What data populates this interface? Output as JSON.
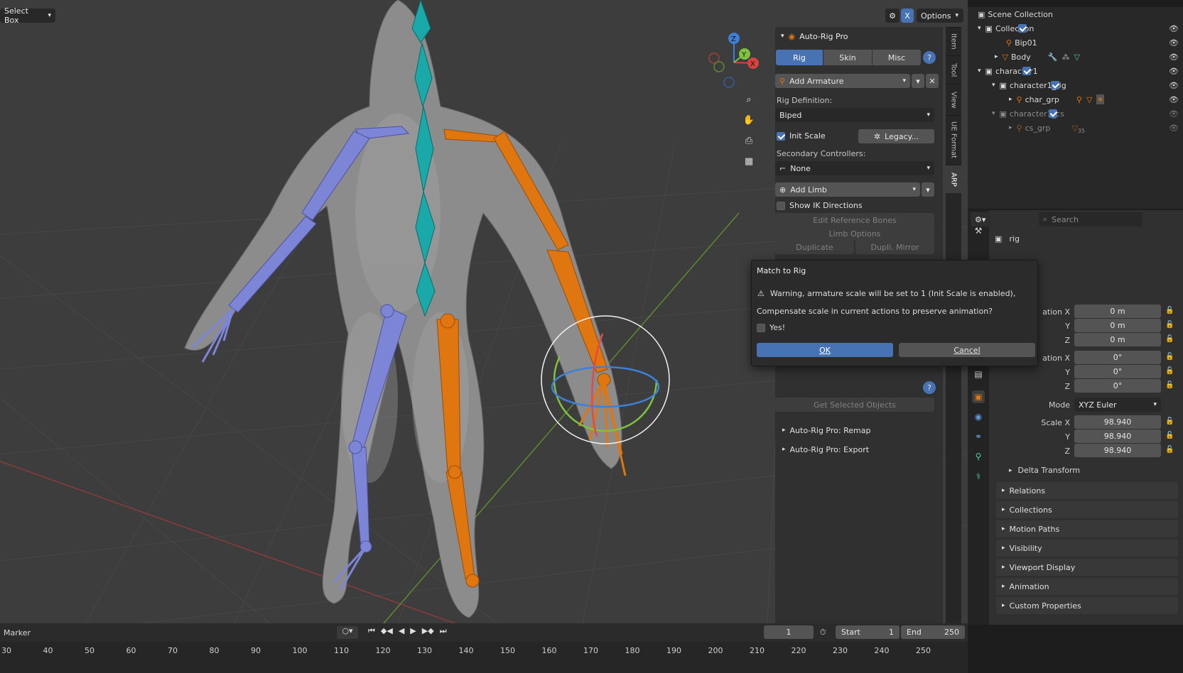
{
  "viewport": {
    "select_mode": "Select Box",
    "options_label": "Options",
    "nav_icons": [
      "zoom-icon",
      "pan-hand-icon",
      "camera-icon",
      "grid-perspective-icon"
    ],
    "gizmo": {
      "x": "X",
      "y": "Y",
      "z": "Z"
    },
    "colors": {
      "left_bones": "#7d85d6",
      "right_bones": "#e0760f",
      "spine_bones": "#1aa8a8",
      "background": "#3d3d3d"
    }
  },
  "side_tabs": [
    "Item",
    "Tool",
    "View",
    "UE Format",
    "ARP"
  ],
  "arp": {
    "title": "Auto-Rig Pro",
    "tabs": [
      "Rig",
      "Skin",
      "Misc"
    ],
    "active_tab": "Rig",
    "add_armature": "Add Armature",
    "rig_definition_label": "Rig Definition:",
    "rig_definition_value": "Biped",
    "init_scale_label": "Init Scale",
    "legacy_label": "Legacy...",
    "secondary_label": "Secondary Controllers:",
    "secondary_value": "None",
    "add_limb": "Add Limb",
    "show_ik": "Show IK Directions",
    "edit_ref_bones": "Edit Reference Bones",
    "limb_options": "Limb Options",
    "duplicate": "Duplicate",
    "dupli_mirror": "Dupli. Mirror",
    "get_selected": "Get Selected Objects",
    "remap": "Auto-Rig Pro: Remap",
    "export": "Auto-Rig Pro: Export"
  },
  "dialog": {
    "title": "Match to Rig",
    "warning": "Warning, armature scale will be set to 1 (Init Scale is enabled),",
    "question": "Compensate scale in current actions to preserve animation?",
    "yes_label": "Yes!",
    "ok": "OK",
    "cancel": "Cancel"
  },
  "outliner": {
    "rows": [
      {
        "name": "Scene Collection",
        "indent": 0
      },
      {
        "name": "Collection",
        "indent": 1
      },
      {
        "name": "Bip01",
        "indent": 2
      },
      {
        "name": "Body",
        "indent": 2
      },
      {
        "name": "character1",
        "indent": 1
      },
      {
        "name": "character1_rig",
        "indent": 2
      },
      {
        "name": "char_grp",
        "indent": 3
      },
      {
        "name": "character1_cs",
        "indent": 2
      },
      {
        "name": "cs_grp",
        "indent": 3
      }
    ],
    "cs_count": "35"
  },
  "properties": {
    "search_placeholder": "Search",
    "object_name": "rig",
    "location": {
      "x_label": "ation X",
      "y_label": "Y",
      "z_label": "Z",
      "x": "0 m",
      "y": "0 m",
      "z": "0 m"
    },
    "rotation": {
      "x_label": "ation X",
      "y_label": "Y",
      "z_label": "Z",
      "x": "0°",
      "y": "0°",
      "z": "0°"
    },
    "mode_label": "Mode",
    "mode_value": "XYZ Euler",
    "scale": {
      "x_label": "Scale X",
      "y_label": "Y",
      "z_label": "Z",
      "x": "98.940",
      "y": "98.940",
      "z": "98.940"
    },
    "delta": "Delta Transform",
    "sections": [
      "Relations",
      "Collections",
      "Motion Paths",
      "Visibility",
      "Viewport Display",
      "Animation",
      "Custom Properties"
    ]
  },
  "timeline": {
    "marker": "Marker",
    "current_frame": "1",
    "start_label": "Start",
    "start": "1",
    "end_label": "End",
    "end": "250",
    "ticks": [
      "30",
      "40",
      "50",
      "60",
      "70",
      "80",
      "90",
      "100",
      "110",
      "120",
      "130",
      "140",
      "150",
      "160",
      "170",
      "180",
      "190",
      "200",
      "210",
      "220",
      "230",
      "240",
      "250"
    ]
  }
}
